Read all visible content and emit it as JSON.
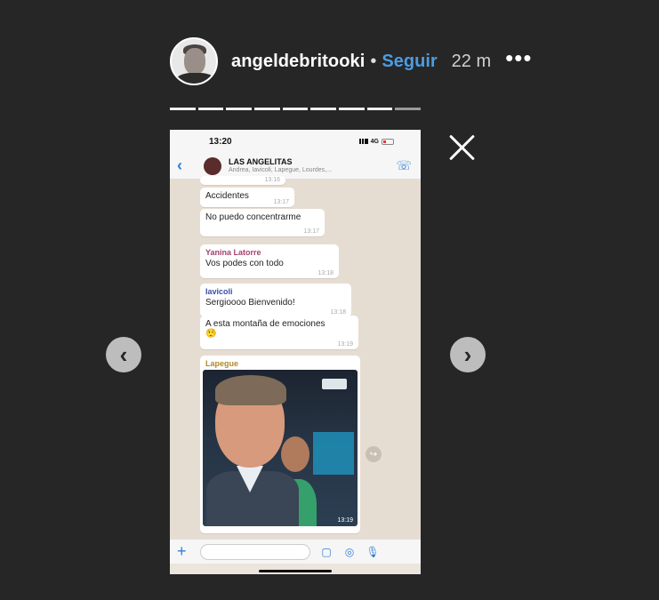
{
  "header": {
    "username": "angeldebritooki",
    "separator": "•",
    "follow_label": "Seguir",
    "time": "22 m",
    "more_icon": "•••"
  },
  "progress": {
    "segments": 9,
    "current_index": 8
  },
  "nav": {
    "prev_icon": "‹",
    "next_icon": "›"
  },
  "phone": {
    "status_time": "13:20",
    "network": "4G",
    "group_name": "LAS ANGELITAS",
    "group_members": "Andrea, Iavicoli, Lapegue, Lourdes,...",
    "back_icon": "‹",
    "call_icon": "☏",
    "messages": [
      {
        "text": "",
        "time": "13:16"
      },
      {
        "text": "Accidentes",
        "time": "13:17"
      },
      {
        "text": "No puedo concentrarme",
        "time": "13:17"
      },
      {
        "sender": "Yanina Latorre",
        "sender_color": "#a3426b",
        "text": "Vos podes con todo",
        "time": "13:18"
      },
      {
        "sender": "Iavicoli",
        "sender_color": "#3b4ea8",
        "text": "Sergioooo Bienvenido!",
        "time": "13:18"
      },
      {
        "text": "A esta montaña de emociones",
        "emoji": "🤥",
        "time": "13:19"
      },
      {
        "sender": "Lapegue",
        "sender_color": "#b08a2c",
        "time": "13:19"
      }
    ],
    "input_plus": "+",
    "sticker_icon": "▢",
    "camera_icon": "◎",
    "mic_icon": "🎙",
    "share_icon": "↪"
  }
}
